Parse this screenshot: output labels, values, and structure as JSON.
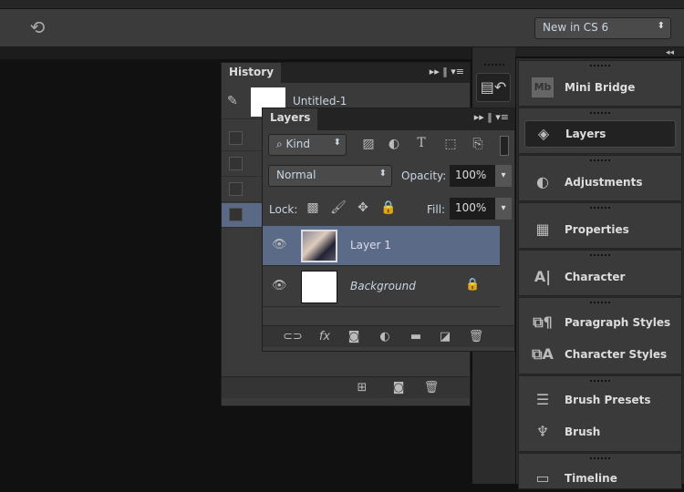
{
  "options_bar": {
    "undo_icon": "rotate-undo-icon",
    "workspace": "New in CS 6"
  },
  "history": {
    "title": "History",
    "snapshot": "Untitled-1",
    "buttons": [
      "new-document-from-state",
      "create-snapshot",
      "delete"
    ]
  },
  "layers": {
    "title": "Layers",
    "filter": "Kind",
    "blend_mode": "Normal",
    "opacity_label": "Opacity:",
    "opacity": "100%",
    "lock_label": "Lock:",
    "fill_label": "Fill:",
    "fill": "100%",
    "rows": [
      {
        "name": "Layer 1",
        "selected": true
      },
      {
        "name": "Background",
        "locked": true
      }
    ],
    "footer_buttons": [
      "link",
      "fx",
      "mask",
      "adjustment",
      "group",
      "new-layer",
      "delete"
    ]
  },
  "dock": {
    "items": [
      "Mini Bridge",
      "Layers",
      "Adjustments",
      "Properties",
      "Character",
      "Paragraph Styles",
      "Character Styles",
      "Brush Presets",
      "Brush",
      "Timeline"
    ],
    "active": "Layers"
  },
  "colors": {
    "selection": "#5b6a86",
    "panel": "#3a3a3a"
  }
}
